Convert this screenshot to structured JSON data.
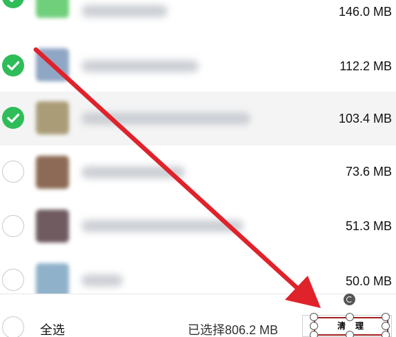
{
  "list": {
    "items": [
      {
        "size": "146.0 MB",
        "checked": true,
        "thumb_color": "#6fcf7a"
      },
      {
        "size": "112.2 MB",
        "checked": true,
        "thumb_color": "#8fa6c4"
      },
      {
        "size": "103.4 MB",
        "checked": true,
        "thumb_color": "#a99c76"
      },
      {
        "size": "73.6 MB",
        "checked": false,
        "thumb_color": "#8c6a55"
      },
      {
        "size": "51.3 MB",
        "checked": false,
        "thumb_color": "#6f5b60"
      },
      {
        "size": "50.0 MB",
        "checked": false,
        "thumb_color": "#8fb1c9"
      }
    ]
  },
  "footer": {
    "select_all_label": "全选",
    "selected_text": "已选择806.2 MB",
    "clean_button_label": "清理"
  },
  "colors": {
    "check_green": "#2ebd59",
    "annotation_red": "#e0222b",
    "button_border": "#a11d1d"
  }
}
